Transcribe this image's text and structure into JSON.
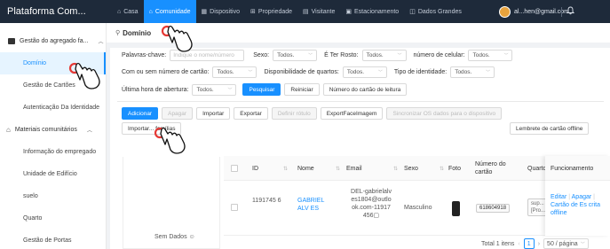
{
  "app": {
    "title": "Plataforma Com..."
  },
  "topnav": {
    "items": [
      {
        "label": "Casa",
        "icon": "home-outline-icon"
      },
      {
        "label": "Comunidade",
        "icon": "home-icon",
        "active": true
      },
      {
        "label": "Dispositivo",
        "icon": "device-icon"
      },
      {
        "label": "Propriedade",
        "icon": "property-icon"
      },
      {
        "label": "Visitante",
        "icon": "visitor-icon"
      },
      {
        "label": "Estacionamento",
        "icon": "parking-icon"
      },
      {
        "label": "Dados Grandes",
        "icon": "chart-icon"
      }
    ],
    "user_email": "al...hen@gmail.com"
  },
  "sidebar": {
    "group1": "Gestão do agregado fa...",
    "group1_items": [
      "Domínio",
      "Gestão de Cartões",
      "Autenticação Da Identidade"
    ],
    "group2": "Materiais comunitários",
    "group2_items": [
      "Informação do empregado",
      "Unidade de Edifício",
      "suelo",
      "Quarto",
      "Gestão de Portas"
    ]
  },
  "page": {
    "title": "Domínio"
  },
  "filters": {
    "keyword_label": "Palavras-chave:",
    "keyword_placeholder": "Indique o nome/número",
    "sexo_label": "Sexo:",
    "sexo_value": "Todos.",
    "rosto_label": "É Ter Rosto:",
    "rosto_value": "Todos.",
    "celular_label": "número de celular:",
    "celular_value": "Todos.",
    "cartao_label": "Com ou sem número de cartão:",
    "cartao_value": "Todos.",
    "quartos_label": "Disponibilidade de quartos:",
    "quartos_value": "Todos.",
    "identidade_label": "Tipo de identidade:",
    "identidade_value": "Todos.",
    "abertura_label": "Última hora de abertura:",
    "abertura_value": "Todos.",
    "search_btn": "Pesquisar",
    "reset_btn": "Reiniciar",
    "card_read_btn": "Número do cartão de leitura"
  },
  "actions": {
    "add": "Adicionar",
    "delete": "Apagar",
    "import": "Importar",
    "export": "Exportar",
    "define_label": "Definir rótulo",
    "export_face": "ExportFaceImagem",
    "sync": "Sincronizar OS dados para o dispositivo",
    "import_families": "Importar... famílias",
    "offline_reminder": "Lembrete de cartão offline"
  },
  "table": {
    "columns": [
      "ID",
      "Nome",
      "Email",
      "Sexo",
      "Foto",
      "Número do cartão",
      "Quarto",
      "Funcionamento"
    ],
    "empty_text": "Sem Dados",
    "rows": [
      {
        "id": "1191745 6",
        "nome": "GABRIEL ALV ES",
        "email": "DEL-gabrielalv es1804@outlo ok.com-11917 456",
        "sexo": "Masculino",
        "cartao": "618604918",
        "quarto": "sup... [Pro...",
        "ops": {
          "edit": "Editar",
          "delete": "Apagar",
          "card": "Cartão de Es crita offline"
        }
      }
    ]
  },
  "pagination": {
    "total": "Total 1 itens",
    "current": "1",
    "page_size": "50 / página"
  },
  "colors": {
    "accent": "#1890ff",
    "topbar": "#1e2a3a",
    "annotation": "#e53935"
  }
}
